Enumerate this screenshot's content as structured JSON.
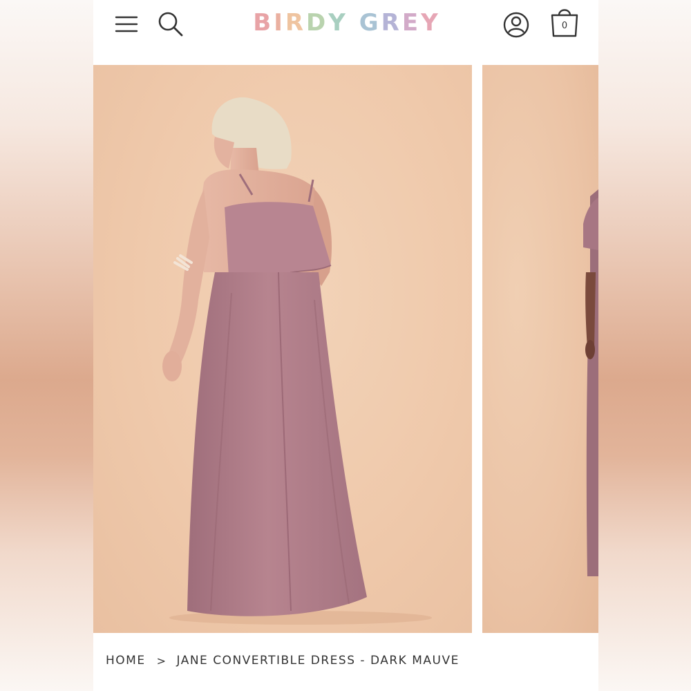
{
  "header": {
    "logo_letters": [
      {
        "char": "B",
        "color": "#e8a3a6"
      },
      {
        "char": "I",
        "color": "#eab0a0"
      },
      {
        "char": "R",
        "color": "#efc4a0"
      },
      {
        "char": "D",
        "color": "#b9d3ae"
      },
      {
        "char": "Y",
        "color": "#a8cfc0"
      },
      {
        "char": " ",
        "color": "#ffffff"
      },
      {
        "char": "G",
        "color": "#a9c3d4"
      },
      {
        "char": "R",
        "color": "#b4b3d6"
      },
      {
        "char": "E",
        "color": "#d2aac8"
      },
      {
        "char": "Y",
        "color": "#e6a6b5"
      }
    ],
    "menu_icon": "hamburger-icon",
    "search_icon": "search-icon",
    "account_icon": "account-icon",
    "cart_icon": "shopping-bag-icon",
    "cart_count": "0"
  },
  "gallery": {
    "dress_color": "#b27f8c",
    "backdrop_color": "#efc9ab"
  },
  "breadcrumb": {
    "home": "HOME",
    "separator": ">",
    "current": "JANE CONVERTIBLE DRESS - DARK MAUVE"
  }
}
